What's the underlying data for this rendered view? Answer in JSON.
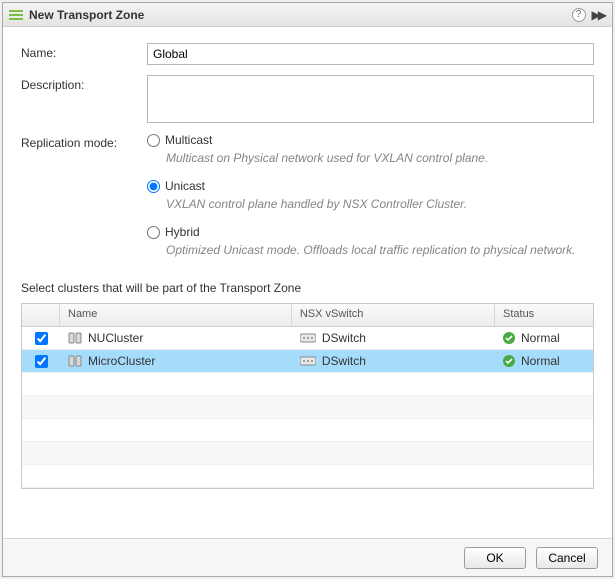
{
  "window": {
    "title": "New Transport Zone"
  },
  "form": {
    "name_label": "Name:",
    "name_value": "Global",
    "description_label": "Description:",
    "description_value": "",
    "replication_label": "Replication mode:",
    "replication": {
      "multicast": {
        "label": "Multicast",
        "desc": "Multicast on Physical network used for VXLAN control plane.",
        "selected": false
      },
      "unicast": {
        "label": "Unicast",
        "desc": "VXLAN control plane handled by NSX Controller Cluster.",
        "selected": true
      },
      "hybrid": {
        "label": "Hybrid",
        "desc": "Optimized Unicast mode. Offloads local traffic replication to physical network.",
        "selected": false
      }
    }
  },
  "clusters": {
    "caption": "Select clusters that will be part of the Transport Zone",
    "columns": {
      "check": "",
      "name": "Name",
      "switch": "NSX vSwitch",
      "status": "Status"
    },
    "rows": [
      {
        "checked": true,
        "name": "NUCluster",
        "switch": "DSwitch",
        "status": "Normal",
        "selected": false
      },
      {
        "checked": true,
        "name": "MicroCluster",
        "switch": "DSwitch",
        "status": "Normal",
        "selected": true
      }
    ]
  },
  "buttons": {
    "ok": "OK",
    "cancel": "Cancel"
  }
}
